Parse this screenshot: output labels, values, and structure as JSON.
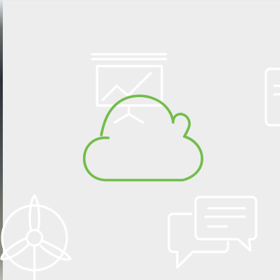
{
  "scene": {
    "background_color": "#ededed",
    "decor_stroke_color": "#ffffff",
    "accent_color": "#72bd4a"
  },
  "icons": [
    {
      "name": "presentation-board-icon",
      "role": "decorative"
    },
    {
      "name": "cloud-icon",
      "role": "featured"
    },
    {
      "name": "document-icon",
      "role": "decorative"
    },
    {
      "name": "wind-turbine-icon",
      "role": "decorative"
    },
    {
      "name": "chat-bubbles-icon",
      "role": "decorative"
    }
  ]
}
